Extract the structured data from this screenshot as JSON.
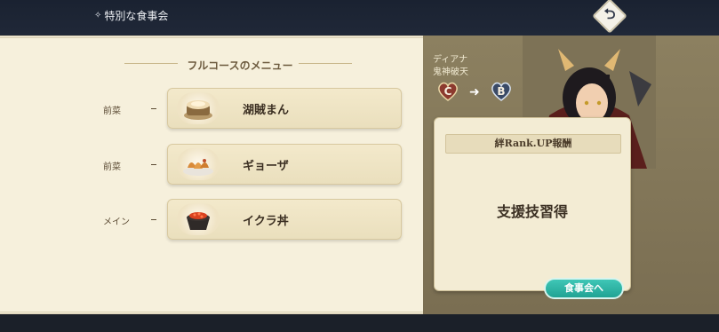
{
  "header": {
    "title": "特別な食事会",
    "title_icon": "sparkle-icon",
    "back_icon": "return-arrow-icon"
  },
  "menu": {
    "heading": "フルコースのメニュー",
    "courses": [
      {
        "course": "前菜",
        "dish": "湖賊まん",
        "icon": "steamed-bun-icon"
      },
      {
        "course": "前菜",
        "dish": "ギョーザ",
        "icon": "dumplings-icon"
      },
      {
        "course": "メイン",
        "dish": "イクラ丼",
        "icon": "salmon-roe-bowl-icon"
      }
    ]
  },
  "character": {
    "name": "ディアナ",
    "title": "鬼神破天",
    "rank_from": "C",
    "rank_to": "B"
  },
  "reward": {
    "header": "絆Rank.UP報酬",
    "text": "支援技習得"
  },
  "buttons": {
    "go_to_meal": "食事会へ"
  },
  "colors": {
    "accent_teal": "#2bb3a4",
    "panel_cream": "#f6f0dc",
    "panel_olive": "#8c8060"
  }
}
